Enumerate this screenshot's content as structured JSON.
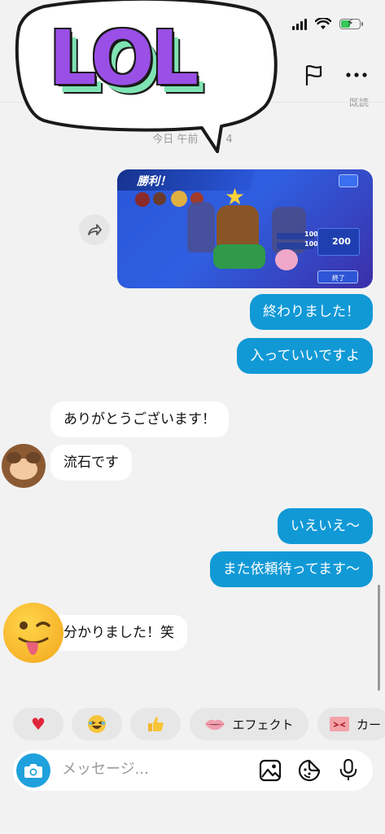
{
  "header": {
    "sticker_text": "LOL",
    "right_partial_text": "既読"
  },
  "chat": {
    "timestamp": "今日 午前",
    "timestamp_suffix": "4",
    "screenshot": {
      "victory_label": "勝利！",
      "reward_value": "200",
      "end_label": "終了",
      "stat_rows": [
        "100",
        "100"
      ]
    },
    "messages": [
      {
        "side": "out",
        "text": "終わりました！"
      },
      {
        "side": "out",
        "text": "入っていいですよ"
      },
      {
        "side": "in",
        "text": "ありがとうございます！"
      },
      {
        "side": "in",
        "text": "流石です"
      },
      {
        "side": "out",
        "text": "いえいえ〜"
      },
      {
        "side": "out",
        "text": "また依頼待ってます〜"
      },
      {
        "side": "in",
        "text": "分かりました！笑"
      }
    ]
  },
  "reactions": [
    {
      "icon": "heart-icon",
      "label": ""
    },
    {
      "icon": "laughing-face-icon",
      "label": ""
    },
    {
      "icon": "thumbs-up-icon",
      "label": ""
    },
    {
      "icon": "lips-icon",
      "label": "エフェクト"
    },
    {
      "icon": "card-icon",
      "label": "カー"
    }
  ],
  "composer": {
    "placeholder": "メッセージ..."
  },
  "colors": {
    "outgoing_bubble": "#1199d6",
    "incoming_bubble": "#ffffff",
    "camera_button": "#1ea1dc",
    "background": "#f2f2f2"
  }
}
